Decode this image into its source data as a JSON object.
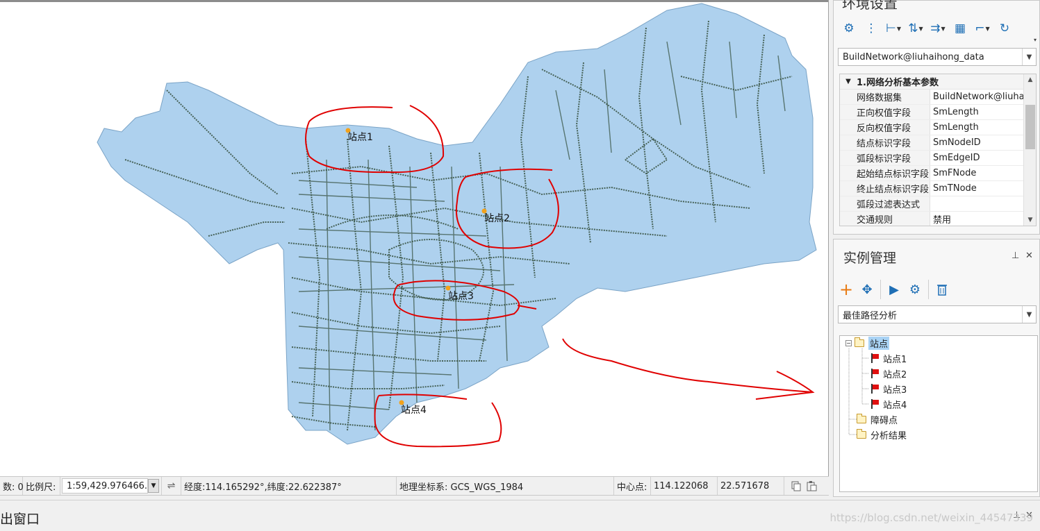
{
  "map": {
    "stations": [
      {
        "label": "站点1"
      },
      {
        "label": "站点2"
      },
      {
        "label": "站点3"
      },
      {
        "label": "站点4"
      }
    ],
    "colors": {
      "land": "#aed1ee",
      "road": "#3a5546",
      "marker": "#f2a21c",
      "annotation": "#e00000"
    }
  },
  "statusbar": {
    "count_label": "数: 0",
    "scale_label": "比例尺:",
    "scale_value": "1:59,429.976466...",
    "swap_icon": "swap-icon",
    "coords": "经度:114.165292°,纬度:22.622387°",
    "crs": "地理坐标系: GCS_WGS_1984",
    "center_label": "中心点:",
    "center_x": "114.122068",
    "center_y": "22.571678"
  },
  "bottom": {
    "title": "出窗口",
    "pin": "⊥",
    "close": "✕",
    "watermark": "https://blog.csdn.net/weixin_44547339"
  },
  "env_panel": {
    "title": "环境设置",
    "network_combo": "BuildNetwork@liuhaihong_data",
    "section_title": "1.网络分析基本参数",
    "rows": [
      {
        "key": "网络数据集",
        "value": "BuildNetwork@liuhail"
      },
      {
        "key": "正向权值字段",
        "value": "SmLength"
      },
      {
        "key": "反向权值字段",
        "value": "SmLength"
      },
      {
        "key": "结点标识字段",
        "value": "SmNodeID"
      },
      {
        "key": "弧段标识字段",
        "value": "SmEdgeID"
      },
      {
        "key": "起始结点标识字段",
        "value": "SmFNode"
      },
      {
        "key": "终止结点标识字段",
        "value": "SmTNode"
      },
      {
        "key": "弧段过滤表达式",
        "value": ""
      },
      {
        "key": "交通规则",
        "value": "禁用"
      }
    ]
  },
  "instance_panel": {
    "title": "实例管理",
    "pin": "⊥",
    "close": "✕",
    "analysis_combo": "最佳路径分析",
    "tree": {
      "root": "站点",
      "children": [
        "站点1",
        "站点2",
        "站点3",
        "站点4"
      ],
      "barriers": "障碍点",
      "results": "分析结果"
    }
  }
}
